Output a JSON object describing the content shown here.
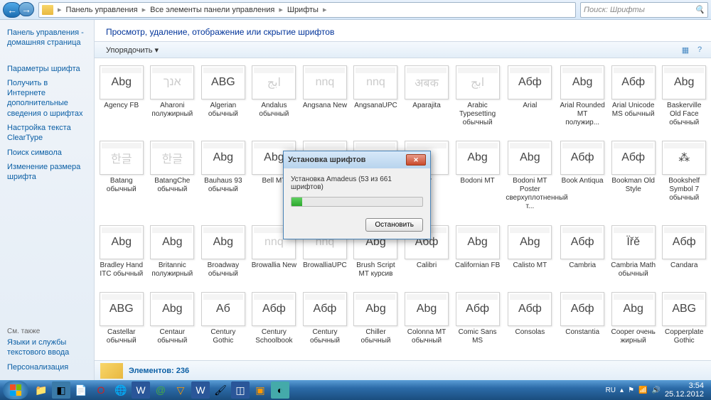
{
  "breadcrumb": {
    "items": [
      "Панель управления",
      "Все элементы панели управления",
      "Шрифты"
    ]
  },
  "search": {
    "placeholder": "Поиск: Шрифты"
  },
  "sidebar": {
    "home": "Панель управления - домашняя страница",
    "links": [
      "Параметры шрифта",
      "Получить в Интернете дополнительные сведения о шрифтах",
      "Настройка текста ClearType",
      "Поиск символа",
      "Изменение размера шрифта"
    ],
    "footer_label": "См. также",
    "footer_links": [
      "Языки и службы текстового ввода",
      "Персонализация"
    ]
  },
  "page": {
    "title": "Просмотр, удаление, отображение или скрытие шрифтов"
  },
  "toolbar": {
    "organize": "Упорядочить ▾"
  },
  "fonts": [
    {
      "s": "Abg",
      "n": "Agency FB",
      "d": 0
    },
    {
      "s": "אנך",
      "n": "Aharoni полужирный",
      "d": 1
    },
    {
      "s": "ABG",
      "n": "Algerian обычный",
      "d": 0
    },
    {
      "s": "ابج",
      "n": "Andalus обычный",
      "d": 1
    },
    {
      "s": "nnq",
      "n": "Angsana New",
      "d": 1
    },
    {
      "s": "nnq",
      "n": "AngsanaUPC",
      "d": 1
    },
    {
      "s": "अबक",
      "n": "Aparajita",
      "d": 1
    },
    {
      "s": "ابج",
      "n": "Arabic Typesetting обычный",
      "d": 1
    },
    {
      "s": "Абф",
      "n": "Arial",
      "d": 0
    },
    {
      "s": "Abg",
      "n": "Arial Rounded MT полужир...",
      "d": 0
    },
    {
      "s": "Абф",
      "n": "Arial Unicode MS обычный",
      "d": 0
    },
    {
      "s": "Abg",
      "n": "Baskerville Old Face обычный",
      "d": 0
    },
    {
      "s": "한글",
      "n": "Batang обычный",
      "d": 1
    },
    {
      "s": "한글",
      "n": "BatangChe обычный",
      "d": 1
    },
    {
      "s": "Abg",
      "n": "Bauhaus 93 обычный",
      "d": 0
    },
    {
      "s": "Abg",
      "n": "Bell MT",
      "d": 0
    },
    {
      "s": "Abg",
      "n": "",
      "d": 0
    },
    {
      "s": "",
      "n": "",
      "d": 0
    },
    {
      "s": "",
      "n": "der",
      "d": 0
    },
    {
      "s": "Abg",
      "n": "Bodoni MT",
      "d": 0
    },
    {
      "s": "Abg",
      "n": "Bodoni MT Poster сверхуплотненный т...",
      "d": 0
    },
    {
      "s": "Абф",
      "n": "Book Antiqua",
      "d": 0
    },
    {
      "s": "Абф",
      "n": "Bookman Old Style",
      "d": 0
    },
    {
      "s": "⁂",
      "n": "Bookshelf Symbol 7 обычный",
      "d": 0
    },
    {
      "s": "Abg",
      "n": "Bradley Hand ITC обычный",
      "d": 0
    },
    {
      "s": "Abg",
      "n": "Britannic полужирный",
      "d": 0
    },
    {
      "s": "Abg",
      "n": "Broadway обычный",
      "d": 0
    },
    {
      "s": "nnq",
      "n": "Browallia New",
      "d": 1
    },
    {
      "s": "nnq",
      "n": "BrowalliaUPC",
      "d": 1
    },
    {
      "s": "Abg",
      "n": "Brush Script MT курсив",
      "d": 0
    },
    {
      "s": "Абф",
      "n": "Calibri",
      "d": 0
    },
    {
      "s": "Abg",
      "n": "Californian FB",
      "d": 0
    },
    {
      "s": "Abg",
      "n": "Calisto MT",
      "d": 0
    },
    {
      "s": "Абф",
      "n": "Cambria",
      "d": 0
    },
    {
      "s": "Ïřě",
      "n": "Cambria Math обычный",
      "d": 0
    },
    {
      "s": "Абф",
      "n": "Candara",
      "d": 0
    },
    {
      "s": "ABG",
      "n": "Castellar обычный",
      "d": 0
    },
    {
      "s": "Abg",
      "n": "Centaur обычный",
      "d": 0
    },
    {
      "s": "Аб",
      "n": "Century Gothic",
      "d": 0
    },
    {
      "s": "Абф",
      "n": "Century Schoolbook",
      "d": 0
    },
    {
      "s": "Абф",
      "n": "Century обычный",
      "d": 0
    },
    {
      "s": "Abg",
      "n": "Chiller обычный",
      "d": 0
    },
    {
      "s": "Abg",
      "n": "Colonna MT обычный",
      "d": 0
    },
    {
      "s": "Абф",
      "n": "Comic Sans MS",
      "d": 0
    },
    {
      "s": "Абф",
      "n": "Consolas",
      "d": 0
    },
    {
      "s": "Абф",
      "n": "Constantia",
      "d": 0
    },
    {
      "s": "Abg",
      "n": "Cooper очень жирный",
      "d": 0
    },
    {
      "s": "ABG",
      "n": "Copperplate Gothic",
      "d": 0
    }
  ],
  "status": {
    "label": "Элементов:",
    "count": "236"
  },
  "dialog": {
    "title": "Установка шрифтов",
    "message": "Установка Amadeus (53 из 661 шрифтов)",
    "button": "Остановить"
  },
  "tray": {
    "lang": "RU",
    "time": "3:54",
    "date": "25.12.2012"
  }
}
